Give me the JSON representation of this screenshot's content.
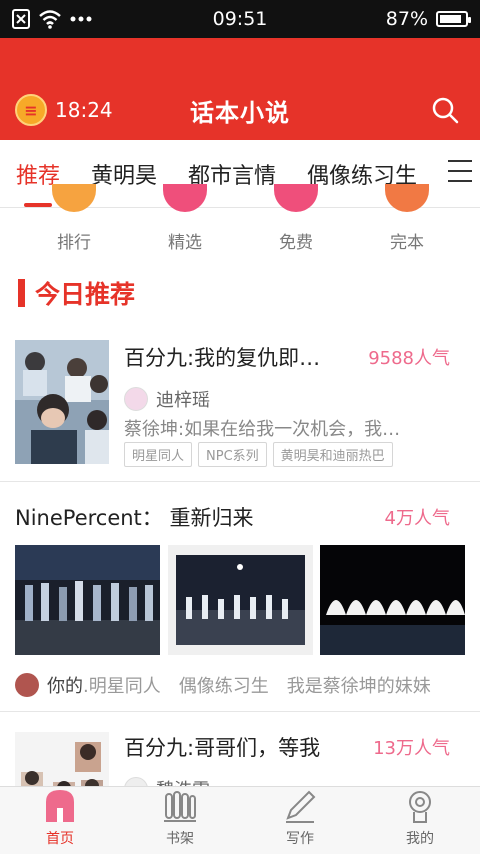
{
  "status_bar": {
    "time": "09:51",
    "battery": "87%",
    "battery_level": 0.87
  },
  "header": {
    "alarm_time": "18:24",
    "title": "话本小说"
  },
  "tabs": [
    {
      "label": "推荐",
      "active": true
    },
    {
      "label": "黄明昊",
      "active": false
    },
    {
      "label": "都市言情",
      "active": false
    },
    {
      "label": "偶像练习生",
      "active": false
    }
  ],
  "quick_categories": [
    {
      "label": "排行",
      "color": "#f6a340"
    },
    {
      "label": "精选",
      "color": "#ef4f7b"
    },
    {
      "label": "免费",
      "color": "#ef4f7b"
    },
    {
      "label": "完本",
      "color": "#f17944"
    }
  ],
  "section": {
    "title": "今日推荐"
  },
  "book1": {
    "title": "百分九:我的复仇即…",
    "popularity": "9588人气",
    "author": "迪梓瑶",
    "description": "蔡徐坤:如果在给我一次机会，我…",
    "tags": [
      "明星同人",
      "NPC系列",
      "黄明昊和迪丽热巴"
    ]
  },
  "group": {
    "title": "NinePercent：  重新归来",
    "popularity": "4万人气",
    "footer_user": "你的",
    "footer_tags": [
      ".明星同人",
      "偶像练习生",
      "我是蔡徐坤的妹妹"
    ]
  },
  "book3": {
    "title": "百分九:哥哥们，等我",
    "popularity": "13万人气",
    "author": "魏浩雷"
  },
  "bottom_nav": [
    {
      "label": "首页",
      "active": true
    },
    {
      "label": "书架",
      "active": false
    },
    {
      "label": "写作",
      "active": false
    },
    {
      "label": "我的",
      "active": false
    }
  ],
  "colors": {
    "accent": "#e63329",
    "popularity": "#ee6a8c"
  }
}
